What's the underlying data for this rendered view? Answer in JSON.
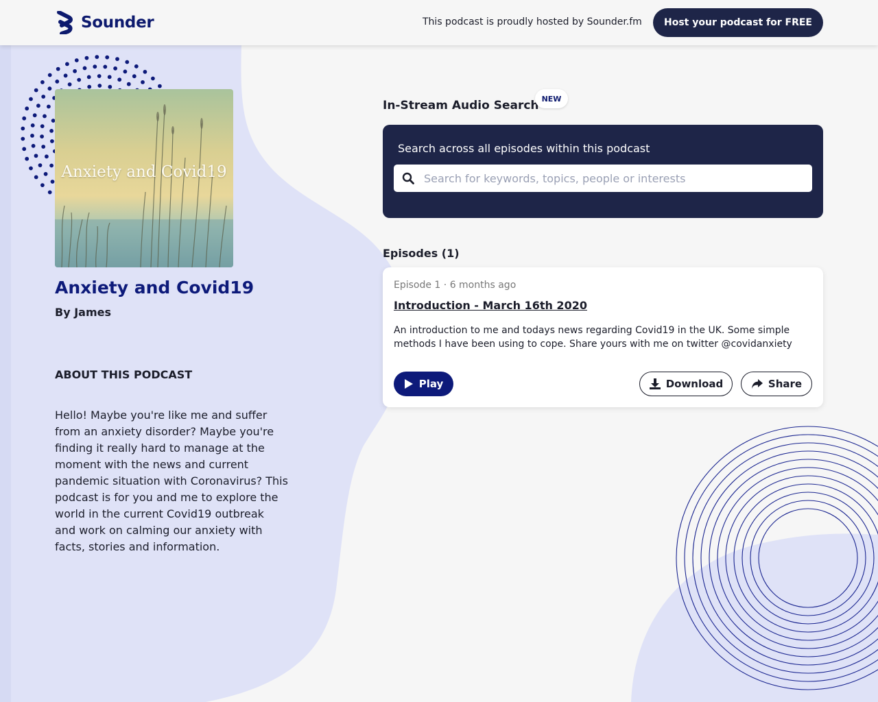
{
  "header": {
    "brand": "Sounder",
    "hosted_text": "This podcast is proudly hosted by Sounder.fm",
    "cta_label": "Host your podcast for FREE"
  },
  "podcast": {
    "cover_text": "Anxiety and Covid19",
    "title": "Anxiety and Covid19",
    "author": "By James",
    "about_heading": "ABOUT THIS PODCAST",
    "about_body": "Hello! Maybe you're like me and suffer from an anxiety disorder? Maybe you're finding it really hard to manage at the moment with the news and current pandemic situation with Coronavirus? This podcast is for you and me to explore the world in the current Covid19 outbreak and work on calming our anxiety with facts, stories and information."
  },
  "search": {
    "heading": "In-Stream Audio Search",
    "badge": "NEW",
    "description": "Search across all episodes within this podcast",
    "placeholder": "Search for keywords, topics, people or interests",
    "value": ""
  },
  "episodes": {
    "heading": "Episodes (1)",
    "items": [
      {
        "meta": "Episode 1 · 6 months ago",
        "title": "Introduction - March 16th 2020",
        "description": "An introduction to me and todays news regarding Covid19 in the UK. Some simple methods I have been using to cope. Share yours with me on twitter @covidanxiety",
        "play_label": "Play",
        "download_label": "Download",
        "share_label": "Share"
      }
    ]
  },
  "colors": {
    "brand_navy": "#0d1a7a",
    "panel_navy": "#1e2548",
    "blob_lavender": "#dfe2f7",
    "page_bg": "#f6f6f6"
  },
  "icons": [
    "sounder-logo-icon",
    "search-icon",
    "play-icon",
    "download-icon",
    "share-icon"
  ]
}
